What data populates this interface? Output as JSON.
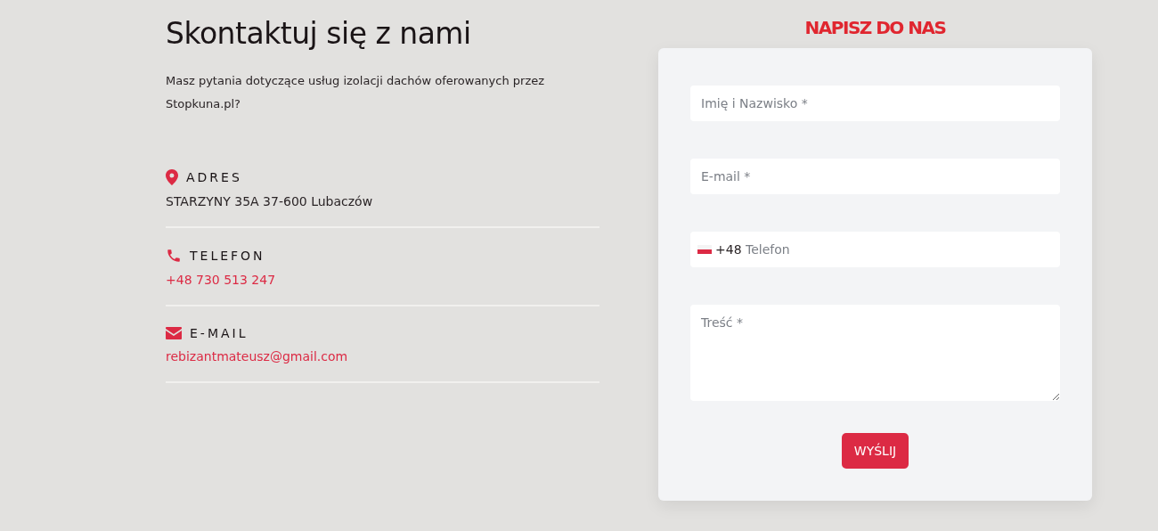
{
  "contact": {
    "title": "Skontaktuj się z nami",
    "intro": "Masz pytania dotyczące usług izolacji dachów oferowanych przez Stopkuna.pl?",
    "items": [
      {
        "kind": "address",
        "label": "ADRES",
        "value": "STARZYNY 35A 37-600 Lubaczów"
      },
      {
        "kind": "phone",
        "label": "TELEFON",
        "value": "+48 730 513 247"
      },
      {
        "kind": "email",
        "label": "E-MAIL",
        "value": "rebizantmateusz@gmail.com"
      }
    ]
  },
  "form": {
    "title": "NAPISZ DO NAS",
    "fields": [
      {
        "kind": "text",
        "placeholder": "Imię i Nazwisko *"
      },
      {
        "kind": "text",
        "placeholder": "E-mail *"
      },
      {
        "kind": "phone",
        "prefix": "+48",
        "placeholder": "Telefon"
      },
      {
        "kind": "textarea",
        "placeholder": "Treść *"
      }
    ],
    "submit": "WYŚLIJ"
  }
}
